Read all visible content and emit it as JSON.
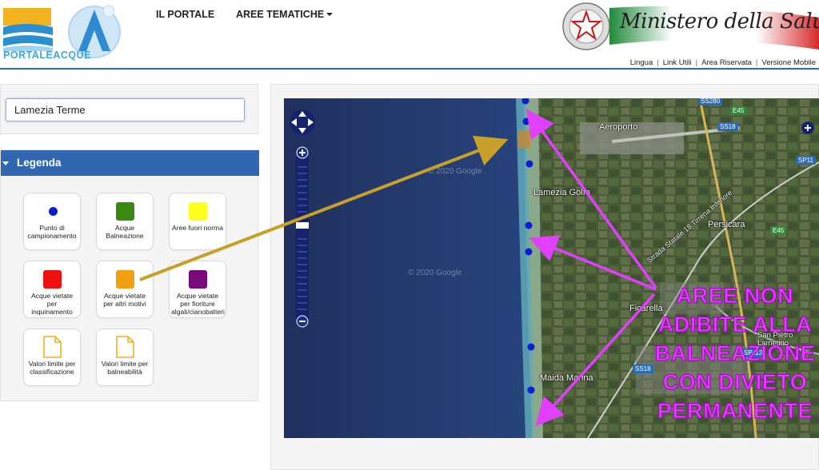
{
  "header": {
    "logo_text": "PORTALEACQUE",
    "nav": [
      {
        "label": "IL PORTALE"
      },
      {
        "label": "AREE TEMATICHE"
      }
    ],
    "ministry_text": "Ministero della Salute",
    "utility_links": [
      "Lingua",
      "Link Utili",
      "Area Riservata",
      "Versione Mobile"
    ]
  },
  "search": {
    "value": "Lamezia Terme"
  },
  "legend": {
    "title": "Legenda",
    "items": [
      {
        "label": "Punto di campionamento",
        "icon": "blue-dot-icon",
        "color": "#0a1cd6"
      },
      {
        "label": "Acque Balneazione",
        "icon": "green-square-icon",
        "color": "#3a8a12"
      },
      {
        "label": "Aree fuori norma",
        "icon": "yellow-square-icon",
        "color": "#ffff22"
      },
      {
        "label": "Acque vietate per inquinamento",
        "icon": "red-square-icon",
        "color": "#ee1111"
      },
      {
        "label": "Acque vietate per altri motivi",
        "icon": "orange-square-icon",
        "color": "#f0a010"
      },
      {
        "label": "Acque vietate per fioriture algali/cianobatteri",
        "icon": "purple-square-icon",
        "color": "#7a0a78"
      },
      {
        "label": "Valori limite per classificazione",
        "icon": "document-icon",
        "color": "#f0b020"
      },
      {
        "label": "Valori limite per balneabilità",
        "icon": "document-icon",
        "color": "#f0b020"
      }
    ]
  },
  "map": {
    "places": [
      "Aeroporto",
      "Lamezia Golfo",
      "Persicara",
      "Ficarella",
      "San Pietro Lametino",
      "Maida Marina",
      "Strada Statale 18 Tirrena Inferiore"
    ],
    "roads": [
      "SS280",
      "E45",
      "SS18",
      "SP113",
      "SP11"
    ],
    "watermarks": [
      "© 2020 Google",
      "© 2020 Google"
    ],
    "annotation_lines": [
      "AREE NON",
      "ADIBITE ALLA",
      "BALNEAZIONE",
      "CON DIVIETO",
      "PERMANENTE"
    ],
    "annotation_color": "#e040fb"
  }
}
